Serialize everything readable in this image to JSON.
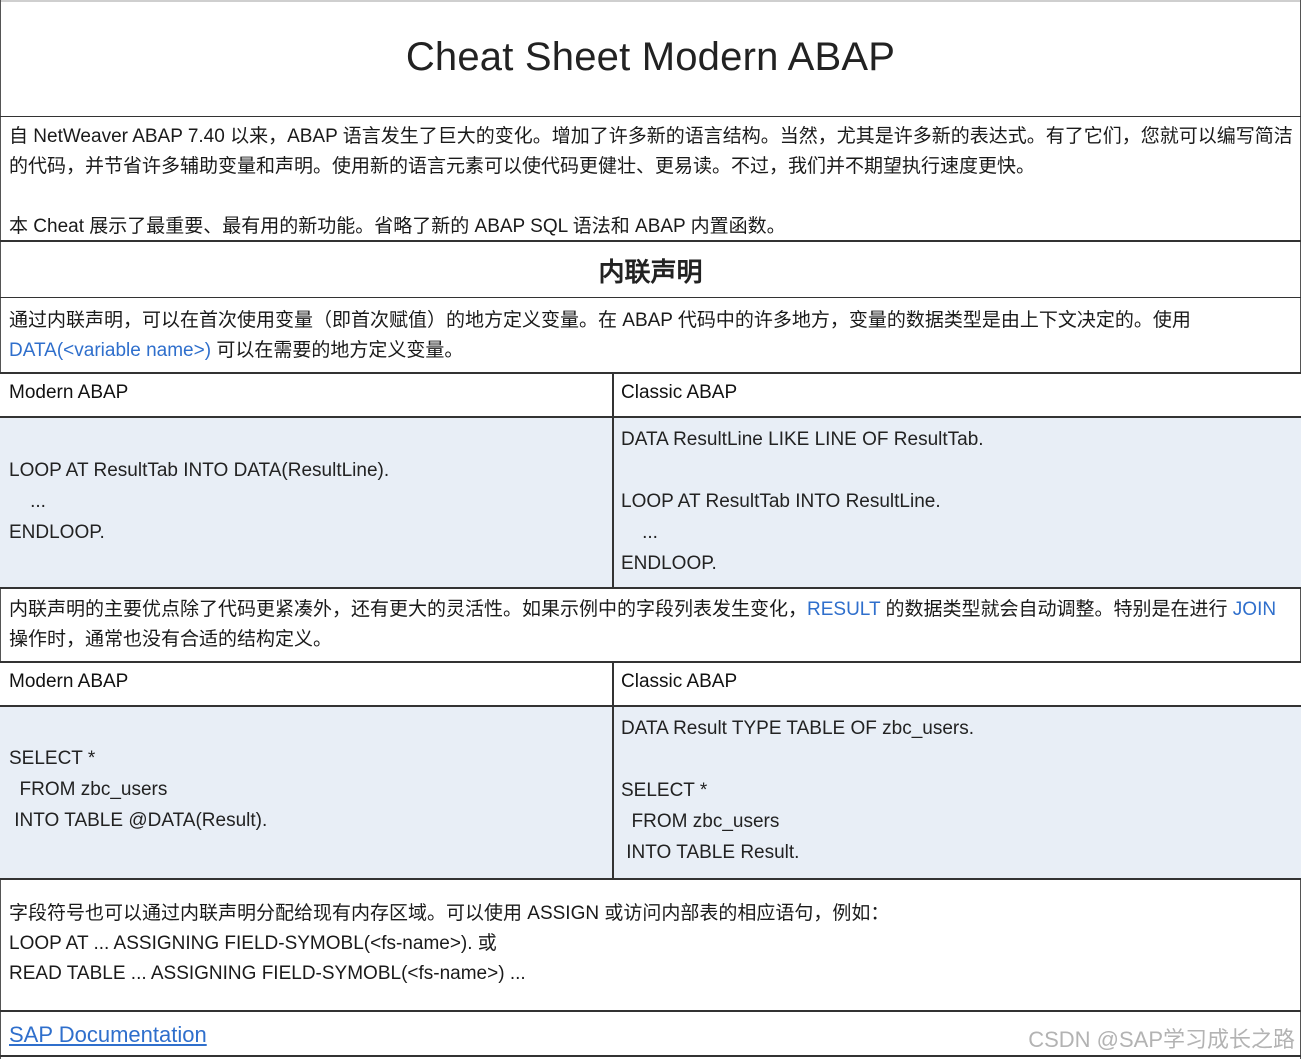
{
  "title": "Cheat Sheet Modern ABAP",
  "intro": {
    "p1": "自 NetWeaver ABAP 7.40 以来，ABAP 语言发生了巨大的变化。增加了许多新的语言结构。当然，尤其是许多新的表达式。有了它们，您就可以编写简洁的代码，并节省许多辅助变量和声明。使用新的语言元素可以使代码更健壮、更易读。不过，我们并不期望执行速度更快。",
    "p2": "本 Cheat 展示了最重要、最有用的新功能。省略了新的 ABAP SQL 语法和 ABAP 内置函数。"
  },
  "section": {
    "heading": "内联声明",
    "desc_before": "通过内联声明，可以在首次使用变量（即首次赋值）的地方定义变量。在 ABAP 代码中的许多地方，变量的数据类型是由上下文决定的。使用 ",
    "desc_kw": "DATA(<variable name>)",
    "desc_after": " 可以在需要的地方定义变量。"
  },
  "table1": {
    "col_modern": "Modern ABAP",
    "col_classic": "Classic ABAP",
    "modern_code": "LOOP AT ResultTab INTO DATA(ResultLine).\n    ...\nENDLOOP.",
    "classic_code": "DATA ResultLine LIKE LINE OF ResultTab.\n\nLOOP AT ResultTab INTO ResultLine.\n    ...\nENDLOOP."
  },
  "middle_text": {
    "part1": "内联声明的主要优点除了代码更紧凑外，还有更大的灵活性。如果示例中的字段列表发生变化，",
    "kw1": "RESULT",
    "part2": " 的数据类型就会自动调整。特别是在进行 ",
    "kw2": "JOIN",
    "part3": " 操作时，通常也没有合适的结构定义。"
  },
  "table2": {
    "col_modern": "Modern ABAP",
    "col_classic": "Classic ABAP",
    "modern_code": "SELECT *\n  FROM zbc_users\n INTO TABLE @DATA(Result).",
    "classic_code": "DATA Result TYPE TABLE OF zbc_users.\n\nSELECT *\n  FROM zbc_users\n INTO TABLE Result."
  },
  "field_symbols": {
    "line1": "字段符号也可以通过内联声明分配给现有内存区域。可以使用 ASSIGN 或访问内部表的相应语句，例如：",
    "line2": "LOOP AT ... ASSIGNING FIELD-SYMOBL(<fs-name>). 或",
    "line3": "READ TABLE ... ASSIGNING FIELD-SYMOBL(<fs-name>) ..."
  },
  "footer": {
    "link": "SAP Documentation",
    "watermark": "CSDN @SAP学习成长之路"
  }
}
